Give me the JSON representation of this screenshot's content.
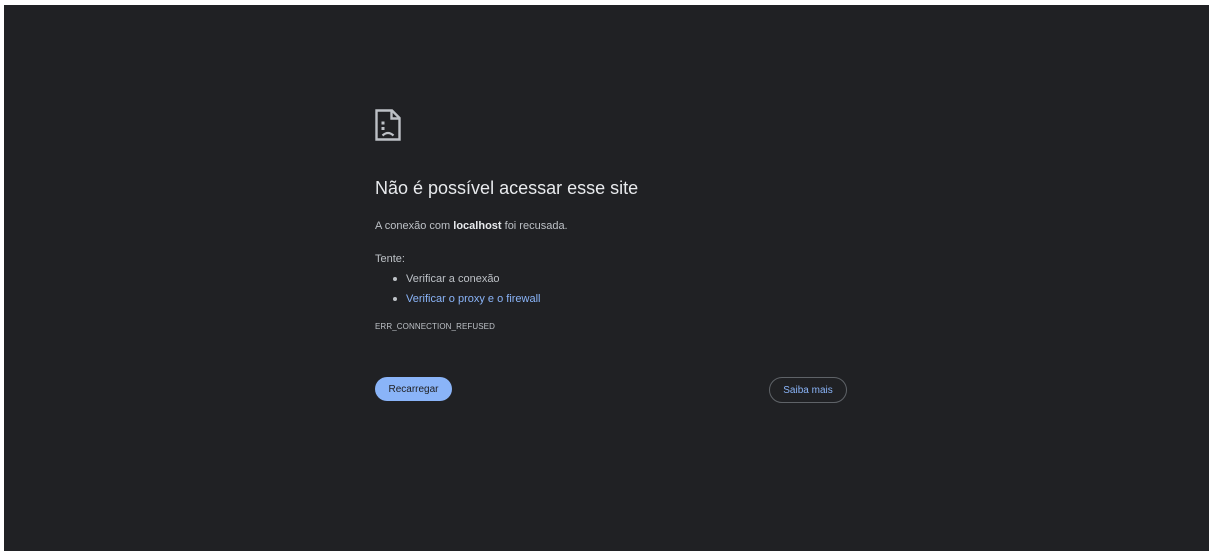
{
  "error_page": {
    "icon": "sad-page-icon",
    "title": "Não é possível acessar esse site",
    "description_prefix": "A conexão com ",
    "host": "localhost",
    "description_suffix": " foi recusada.",
    "try_label": "Tente:",
    "suggestions": [
      "Verificar a conexão",
      "Verificar o proxy e o firewall"
    ],
    "error_code": "ERR_CONNECTION_REFUSED",
    "reload_label": "Recarregar",
    "details_label": "Saiba mais"
  },
  "colors": {
    "background": "#202124",
    "title": "#e8eaed",
    "text": "#bdc1c6",
    "link": "#8ab4f8",
    "primary_button": "#8ab4f8"
  }
}
